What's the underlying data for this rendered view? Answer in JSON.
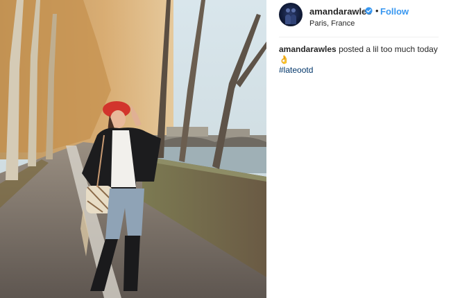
{
  "post": {
    "username": "amandarawles",
    "separator": "•",
    "follow_label": "Follow",
    "location": "Paris, France",
    "caption_user": "amandarawles",
    "caption_text": "posted a lil too much today",
    "caption_emoji": "👌",
    "hashtag": "#lateootd"
  },
  "icons": {
    "verified": "verified-badge-icon",
    "avatar": "profile-avatar"
  },
  "colors": {
    "accent": "#3897f0",
    "verified": "#3897f0",
    "hashtag": "#003569"
  }
}
